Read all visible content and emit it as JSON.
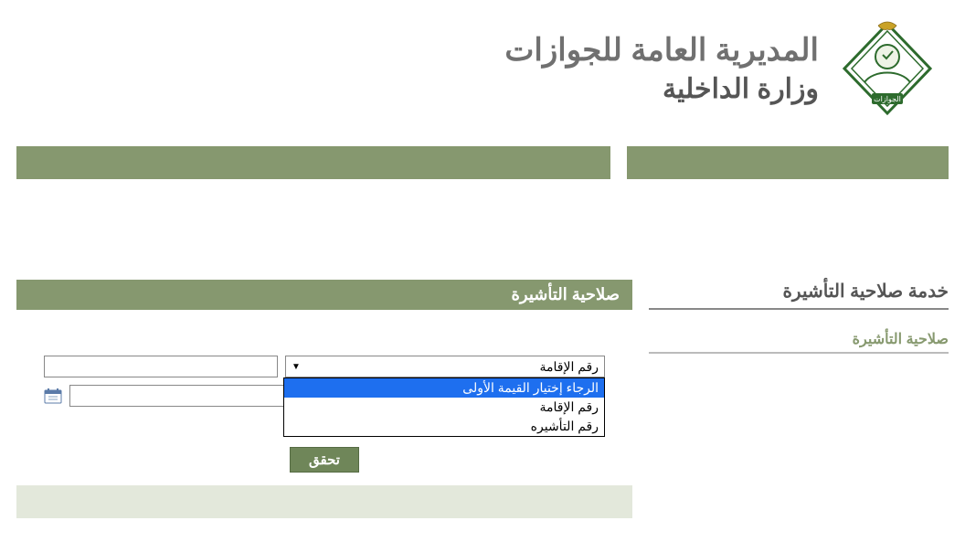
{
  "header": {
    "title": "المديرية العامة للجوازات",
    "subtitle": "وزارة الداخلية",
    "logo_text": "الجوازات"
  },
  "sidebar": {
    "service_title": "خدمة صلاحية التأشيرة",
    "link": "صلاحية التأشيرة"
  },
  "panel": {
    "title": "صلاحية التأشيرة"
  },
  "form": {
    "select_value": "رقم الإقامة",
    "options": [
      "الرجاء إختيار القيمة الأولى",
      "رقم الإقامة",
      "رقم التأشيره"
    ],
    "input1_value": "",
    "input2_value": "",
    "submit_label": "تحقق"
  },
  "colors": {
    "olive": "#86986f",
    "olive_dark": "#6f8659",
    "highlight": "#1e6fef"
  }
}
